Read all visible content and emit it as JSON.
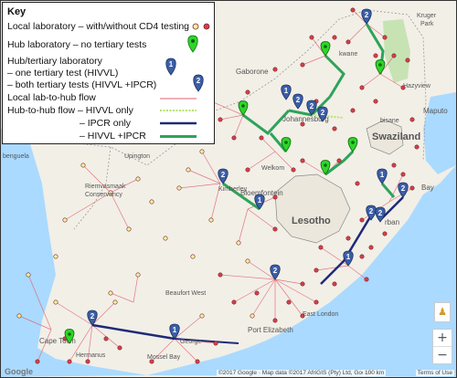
{
  "legend": {
    "title": "Key",
    "local_lab": "Local laboratory – with/without CD4 testing",
    "hub_lab": "Hub laboratory – no tertiary tests",
    "hub_tertiary": "Hub/tertiary laboratory",
    "one_test": "– one tertiary test (HIVVL)",
    "both_tests": "– both tertiary tests (HIVVL +IPCR)",
    "local_flow": "Local lab-to-hub flow",
    "hub_flow_hivvl": "Hub-to-hub flow – HIVVL only",
    "hub_flow_ipcr": "– IPCR only",
    "hub_flow_both": "– HIVVL +IPCR",
    "colors": {
      "local_flow": "#e06070",
      "hivvl_only": "#b5e36a",
      "ipcr_only": "#1e2a78",
      "hivvl_ipcr": "#2ea35a",
      "local_lab_red": "#d44048",
      "local_lab_yellow": "#f4f0a0",
      "hub_green": "#2fd52a",
      "tertiary_blue": "#3b5ea8"
    }
  },
  "places": {
    "swaziland": "Swaziland",
    "lesotho": "Lesotho",
    "gaborone": "Gaborone",
    "bloemfontein": "Bloemfontein",
    "welkom": "Welkom",
    "kimberley": "Kimberley",
    "upington": "Upington",
    "maputo": "Maputo",
    "johannesburg": "Johannesburg",
    "port_elizabeth": "Port Elizabeth",
    "east_london": "East London",
    "cape_town": "Cape Town",
    "mossel_bay": "Mossel Bay",
    "beaufort_west": "Beaufort West",
    "george": "George",
    "hermanus": "Hermanus",
    "richards_bay": "Bay",
    "kruger": "Kruger",
    "park": "Park",
    "hazyview": "Hazyview",
    "riemvasmaak": "Riemvasmaak",
    "conservancy": "Conservancy",
    "bisane": "bisane",
    "benguela": "benguela",
    "durban": "rban",
    "polokwane": "kwane"
  },
  "tertiary_labels": [
    "2",
    "2",
    "2",
    "2",
    "2",
    "1",
    "2",
    "1",
    "2",
    "2",
    "2",
    "2",
    "1",
    "1",
    "1"
  ],
  "footer": {
    "google": "Google",
    "attribution": "©2017 Google · Map data ©2017 AfriGIS (Pty) Ltd, Google",
    "scale": "100 km",
    "terms": "Terms of Use"
  },
  "controls": {
    "zoom_in": "+",
    "zoom_out": "−",
    "pegman": "♟"
  }
}
